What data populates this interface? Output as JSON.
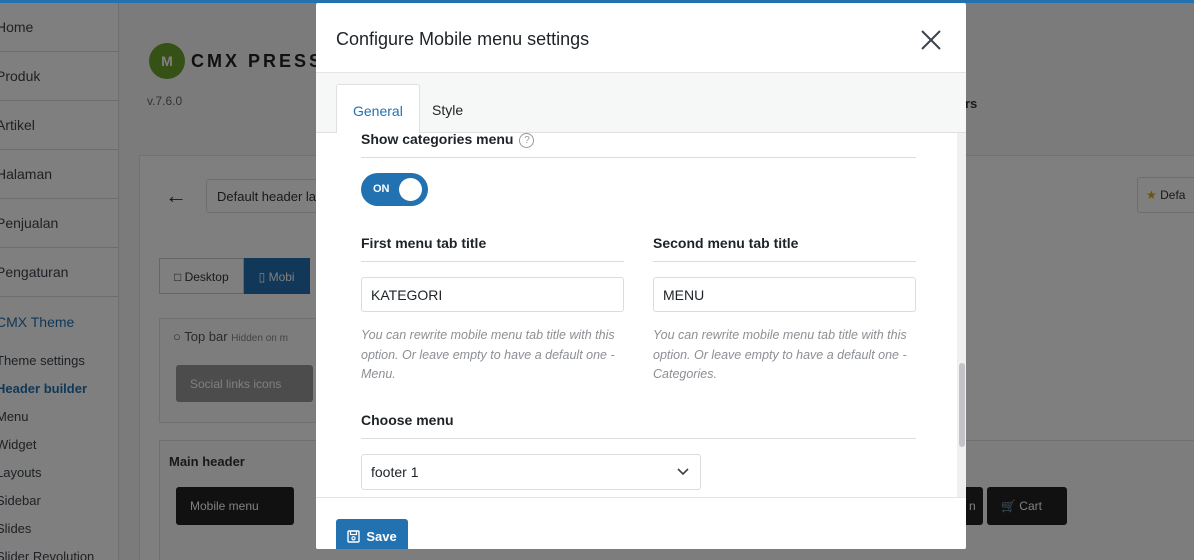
{
  "sidebar": {
    "items": [
      {
        "label": "Home"
      },
      {
        "label": "Produk"
      },
      {
        "label": "Artikel"
      },
      {
        "label": "Halaman"
      },
      {
        "label": "Penjualan"
      },
      {
        "label": "Pengaturan"
      }
    ],
    "current": {
      "label": "CMX Theme"
    },
    "subitems": [
      {
        "label": "Theme settings"
      },
      {
        "label": "Header builder"
      },
      {
        "label": "Menu"
      },
      {
        "label": "Widget"
      },
      {
        "label": "Layouts"
      },
      {
        "label": "Sidebar"
      },
      {
        "label": "Slides"
      },
      {
        "label": "Slider Revolution"
      }
    ]
  },
  "background": {
    "logo_text": "CMX PRESS",
    "logo_mark": "M",
    "version": "v.7.6.0",
    "header_select": "Default header la",
    "default_right": "Defa",
    "top_right_link": "rs",
    "tabs": {
      "desktop": "Desktop",
      "mobile": "Mobi"
    },
    "top_bar_label": "Top bar",
    "hidden_label": "Hidden on m",
    "social_links": "Social links icons",
    "main_header": "Main header",
    "mobile_menu": "Mobile menu",
    "chip_n": "n",
    "cart": "Cart"
  },
  "modal": {
    "title": "Configure Mobile menu settings",
    "tabs": {
      "general": "General",
      "style": "Style"
    },
    "show_categories": {
      "label": "Show categories menu",
      "help": "?",
      "toggle_text": "ON",
      "value": true
    },
    "first_tab": {
      "label": "First menu tab title",
      "value": "KATEGORI",
      "description": "You can rewrite mobile menu tab title with this option. Or leave empty to have a default one - Menu."
    },
    "second_tab": {
      "label": "Second menu tab title",
      "value": "MENU",
      "description": "You can rewrite mobile menu tab title with this option. Or leave empty to have a default one - Categories."
    },
    "choose_menu": {
      "label": "Choose menu",
      "selected": "footer 1"
    },
    "save_label": "Save"
  },
  "colors": {
    "accent": "#2271b1",
    "overlay": "rgba(0,0,0,0.5)"
  }
}
